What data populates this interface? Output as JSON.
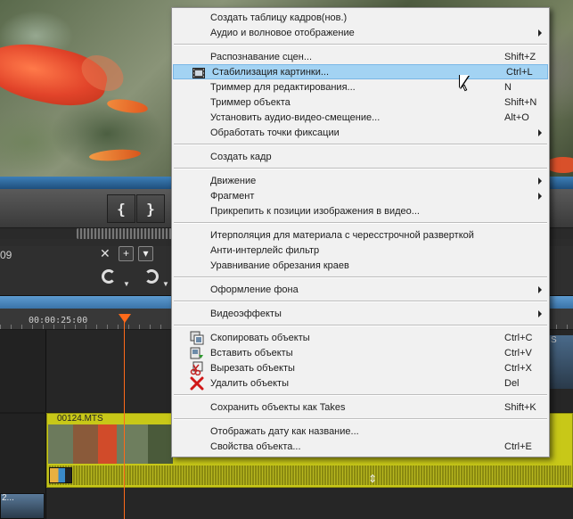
{
  "timeline": {
    "timecode_partial": "09",
    "close_glyph": "✕",
    "add_glyph": "+",
    "dropdown_glyph": "▾",
    "ruler_time": "00:00:25:00",
    "clip_name": "00124.MTS",
    "right_clip_label": "S",
    "bottom_clip_label": "2..."
  },
  "transport": {
    "mark_in": "{",
    "mark_out": "}"
  },
  "context_menu": {
    "items": [
      {
        "type": "item",
        "label": "Создать таблицу кадров(нов.)",
        "shortcut": "",
        "submenu": false,
        "icon": ""
      },
      {
        "type": "item",
        "label": "Аудио и волновое отображение",
        "shortcut": "",
        "submenu": true,
        "icon": ""
      },
      {
        "type": "separator"
      },
      {
        "type": "item",
        "label": "Распознавание сцен...",
        "shortcut": "Shift+Z",
        "submenu": false,
        "icon": ""
      },
      {
        "type": "item",
        "label": "Стабилизация картинки...",
        "shortcut": "Ctrl+L",
        "submenu": false,
        "icon": "filmstrip-icon",
        "highlighted": true
      },
      {
        "type": "item",
        "label": "Триммер для редактирования...",
        "shortcut": "N",
        "submenu": false,
        "icon": ""
      },
      {
        "type": "item",
        "label": "Триммер объекта",
        "shortcut": "Shift+N",
        "submenu": false,
        "icon": ""
      },
      {
        "type": "item",
        "label": "Установить аудио-видео-смещение...",
        "shortcut": "Alt+O",
        "submenu": false,
        "icon": ""
      },
      {
        "type": "item",
        "label": "Обработать точки фиксации",
        "shortcut": "",
        "submenu": true,
        "icon": ""
      },
      {
        "type": "separator"
      },
      {
        "type": "item",
        "label": "Создать кадр",
        "shortcut": "",
        "submenu": false,
        "icon": ""
      },
      {
        "type": "separator"
      },
      {
        "type": "item",
        "label": "Движение",
        "shortcut": "",
        "submenu": true,
        "icon": ""
      },
      {
        "type": "item",
        "label": "Фрагмент",
        "shortcut": "",
        "submenu": true,
        "icon": ""
      },
      {
        "type": "item",
        "label": "Прикрепить к позиции изображения в видео...",
        "shortcut": "",
        "submenu": false,
        "icon": ""
      },
      {
        "type": "separator"
      },
      {
        "type": "item",
        "label": "Итерполяция для материала с чересстрочной разверткой",
        "shortcut": "",
        "submenu": false,
        "icon": ""
      },
      {
        "type": "item",
        "label": "Анти-интерлейс фильтр",
        "shortcut": "",
        "submenu": false,
        "icon": ""
      },
      {
        "type": "item",
        "label": "Уравнивание обрезания краев",
        "shortcut": "",
        "submenu": false,
        "icon": ""
      },
      {
        "type": "separator"
      },
      {
        "type": "item",
        "label": "Оформление фона",
        "shortcut": "",
        "submenu": true,
        "icon": ""
      },
      {
        "type": "separator"
      },
      {
        "type": "item",
        "label": "Видеоэффекты",
        "shortcut": "",
        "submenu": true,
        "icon": ""
      },
      {
        "type": "separator"
      },
      {
        "type": "item",
        "label": "Скопировать объекты",
        "shortcut": "Ctrl+C",
        "submenu": false,
        "icon": "copy-icon"
      },
      {
        "type": "item",
        "label": "Вставить объекты",
        "shortcut": "Ctrl+V",
        "submenu": false,
        "icon": "paste-icon"
      },
      {
        "type": "item",
        "label": "Вырезать объекты",
        "shortcut": "Ctrl+X",
        "submenu": false,
        "icon": "cut-icon"
      },
      {
        "type": "item",
        "label": "Удалить объекты",
        "shortcut": "Del",
        "submenu": false,
        "icon": "delete-icon"
      },
      {
        "type": "separator"
      },
      {
        "type": "item",
        "label": "Сохранить объекты как Takes",
        "shortcut": "Shift+K",
        "submenu": false,
        "icon": ""
      },
      {
        "type": "separator"
      },
      {
        "type": "item",
        "label": "Отображать дату как название...",
        "shortcut": "",
        "submenu": false,
        "icon": ""
      },
      {
        "type": "item",
        "label": "Свойства объекта...",
        "shortcut": "Ctrl+E",
        "submenu": false,
        "icon": ""
      }
    ]
  }
}
